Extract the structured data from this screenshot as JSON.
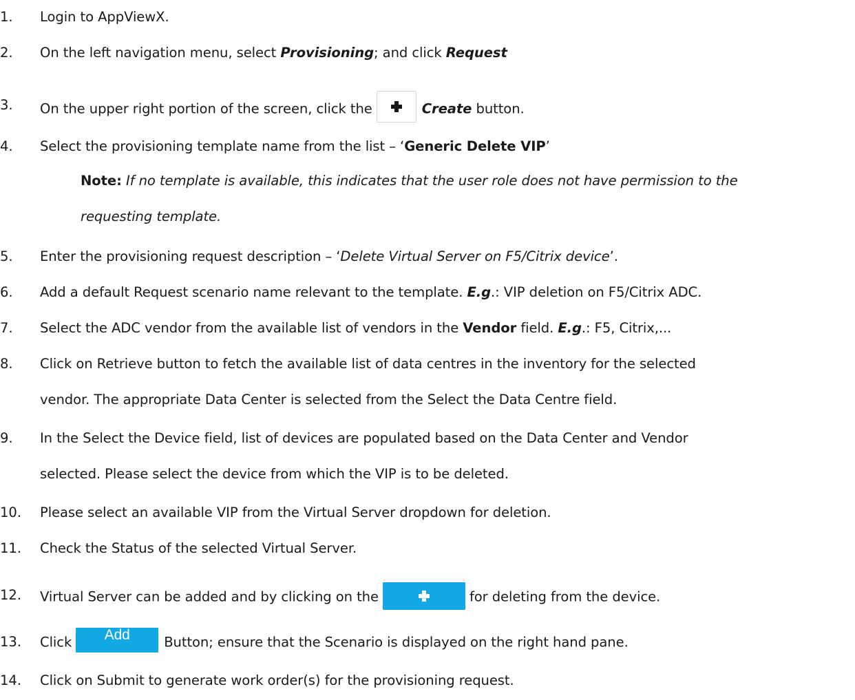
{
  "steps": [
    {
      "num": "1.",
      "parts": [
        "Login to AppViewX."
      ]
    },
    {
      "num": "2.",
      "parts": [
        "On the left navigation menu, select ",
        "Provisioning",
        "; and click ",
        "Request"
      ]
    },
    {
      "num": "3.",
      "parts": [
        "On the upper right portion of the screen, click the",
        "Create",
        " button."
      ]
    },
    {
      "num": "4.",
      "parts": [
        "Select the provisioning template name from the list – ‘",
        "Generic Delete VIP",
        "’"
      ]
    },
    {
      "num": "5.",
      "parts": [
        "Enter the provisioning request description – ‘",
        "Delete Virtual Server on F5/Citrix device",
        "’."
      ]
    },
    {
      "num": "6.",
      "parts": [
        "Add a default Request scenario name relevant to the template. ",
        "E.g",
        ".: VIP deletion on F5/Citrix ADC."
      ]
    },
    {
      "num": "7.",
      "parts": [
        "Select the ADC vendor from the available list of vendors in the ",
        "Vendor",
        " field. ",
        "E.g",
        ".: F5, Citrix,..."
      ]
    },
    {
      "num": "8.",
      "parts": [
        "Click on Retrieve button to fetch the available list of data centres in the inventory for the selected",
        "vendor.  The appropriate Data Center is selected from the Select the Data Centre field."
      ]
    },
    {
      "num": "9.",
      "parts": [
        "In the Select the Device field, list of devices are populated based on the Data Center and Vendor",
        "selected. Please select the device from which the VIP is to be deleted."
      ]
    },
    {
      "num": "10.",
      "parts": [
        "Please select an available VIP from the Virtual Server dropdown for deletion."
      ]
    },
    {
      "num": "11.",
      "parts": [
        "Check the Status of the selected Virtual Server."
      ]
    },
    {
      "num": "12.",
      "parts": [
        "Virtual Server can be added and by clicking on the",
        "for deleting from the device."
      ]
    },
    {
      "num": "13.",
      "parts": [
        "Click",
        "Button; ensure that the Scenario is displayed on the right hand pane."
      ]
    },
    {
      "num": "14.",
      "parts": [
        "Click on Submit to generate work order(s) for the provisioning request."
      ]
    }
  ],
  "note": {
    "label": "Note:",
    "line1": " If no template is available, this indicates that the user role does not have permission to the",
    "line2": "requesting template."
  },
  "buttons": {
    "create_icon": "plus-icon",
    "add_vs_icon": "plus-icon",
    "add_label": "Add",
    "accent_color": "#12a8e6"
  }
}
